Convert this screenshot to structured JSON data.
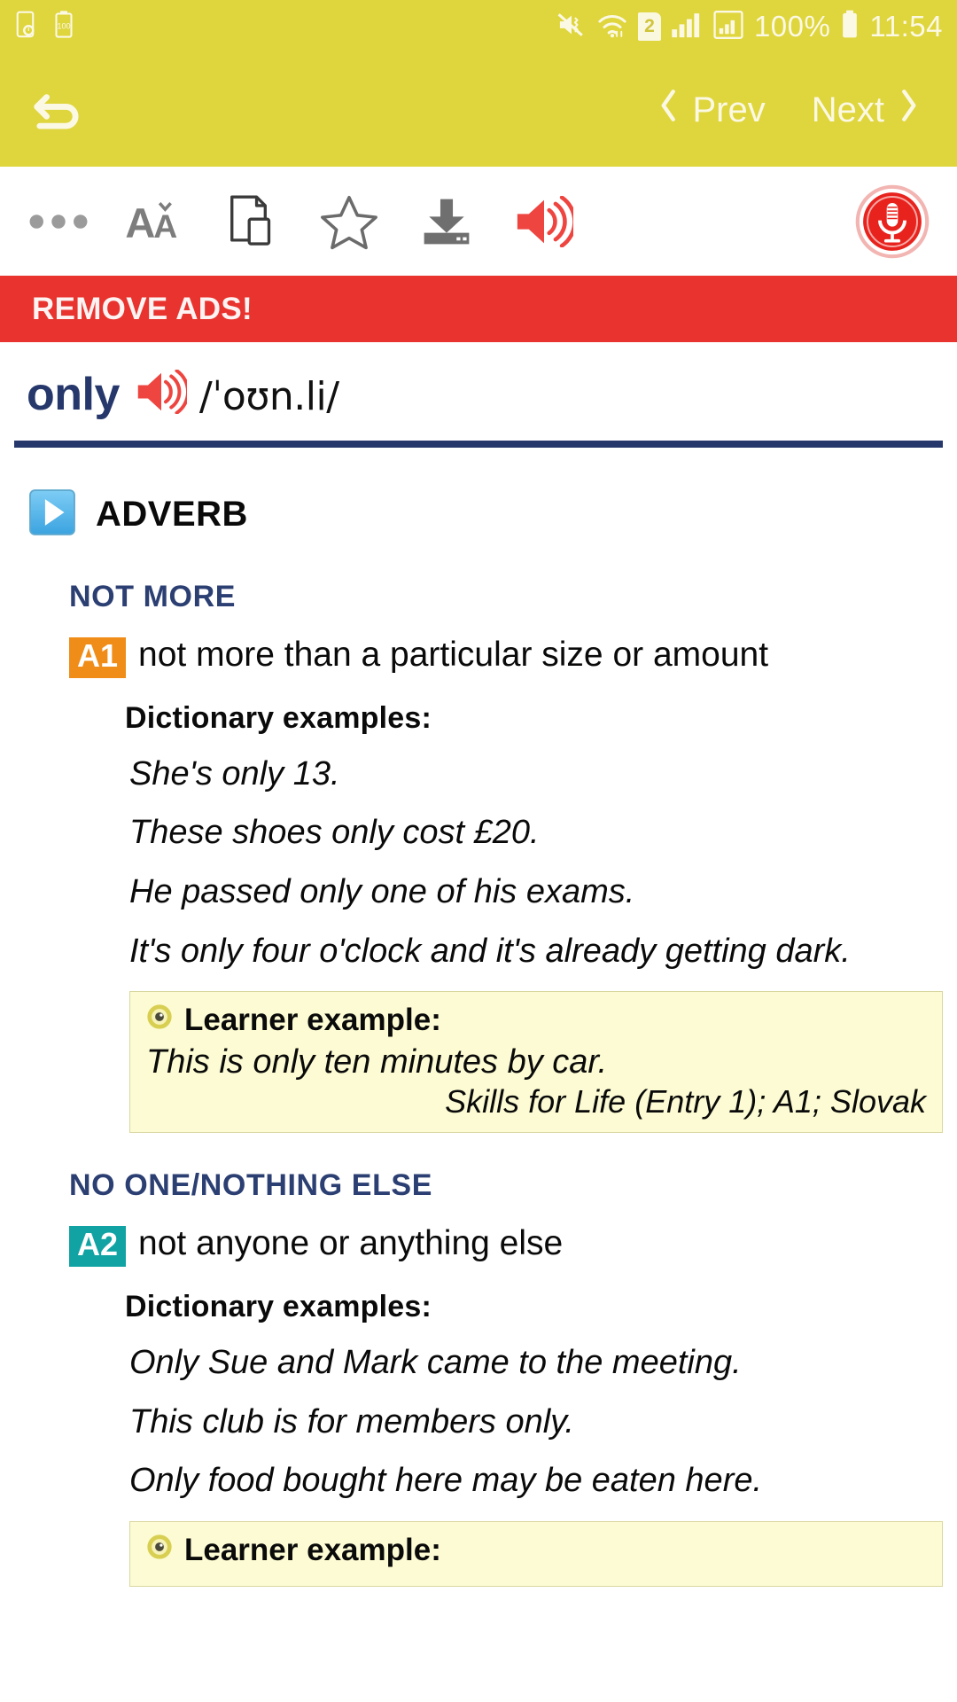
{
  "status_bar": {
    "icons_left": [
      "clock-device-icon",
      "battery-saver-icon"
    ],
    "icons_right": [
      "mute-vibrate-icon",
      "wifi-icon",
      "sim-2-icon",
      "signal-bars-icon",
      "mobile-data-icon"
    ],
    "sim_label": "2",
    "battery_percent": "100%",
    "time": "11:54",
    "bg_color": "#dfd53c"
  },
  "nav_bar": {
    "back_icon": "back-arrow-icon",
    "prev_label": "Prev",
    "next_label": "Next",
    "prev_icon": "chevron-left-icon",
    "next_icon": "chevron-right-icon"
  },
  "toolbar": {
    "items": [
      {
        "name": "overflow-menu-icon"
      },
      {
        "name": "font-size-icon"
      },
      {
        "name": "copy-page-icon"
      },
      {
        "name": "favorite-star-icon"
      },
      {
        "name": "download-icon"
      },
      {
        "name": "audio-speaker-icon"
      }
    ],
    "mic_icon": "microphone-icon",
    "accent_red": "#e8332e"
  },
  "ads_banner": {
    "label": "REMOVE ADS!",
    "bg_color": "#e8332e"
  },
  "entry": {
    "headword": "only",
    "speaker_icon": "audio-speaker-icon",
    "pronunciation": "/ˈoʊn.li/",
    "headword_color": "#26386b",
    "part_of_speech": "ADVERB",
    "pos_icon": "play-expand-icon",
    "senses": [
      {
        "guideword": "NOT MORE",
        "level": "A1",
        "level_color": "#f08c18",
        "definition": "not more than a particular size or amount",
        "examples_label": "Dictionary examples:",
        "examples": [
          "She's only 13.",
          "These shoes only cost £20.",
          "He passed only one of his exams.",
          "It's only four o'clock and it's already getting dark."
        ],
        "learner": {
          "icon": "learner-eye-icon",
          "label": "Learner example:",
          "sentence": "This is only ten minutes by car.",
          "source": "Skills for Life (Entry 1); A1; Slovak"
        }
      },
      {
        "guideword": "NO ONE/NOTHING ELSE",
        "level": "A2",
        "level_color": "#11a3a3",
        "definition": "not anyone or anything else",
        "examples_label": "Dictionary examples:",
        "examples": [
          "Only Sue and Mark came to the meeting.",
          "This club is for members only.",
          "Only food bought here may be eaten here."
        ],
        "learner": {
          "icon": "learner-eye-icon",
          "label": "Learner example:",
          "sentence": "",
          "source": ""
        }
      }
    ]
  }
}
